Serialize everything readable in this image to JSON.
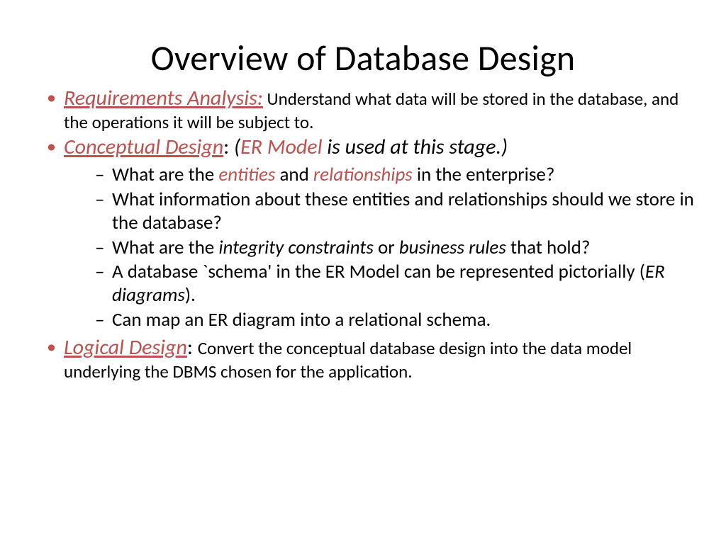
{
  "title": "Overview of Database Design",
  "bullets": [
    {
      "kw": "Requirements Analysis:",
      "rest": " Understand what data will be stored in the database, and the operations it will be subject to."
    },
    {
      "kw": "Conceptual Design",
      "colon": ":  ",
      "paren_open": "(",
      "er": "ER Model",
      "paren_rest": " is used at this stage.)",
      "subs": [
        {
          "pre": "What are the ",
          "h1": "entities",
          "mid": " and ",
          "h2": "relationships",
          "post": " in the enterprise?"
        },
        {
          "pre": "What information about these entities and relationships should we store in the database?"
        },
        {
          "pre": "What are the ",
          "i1": "integrity constraints",
          "mid": " or ",
          "i2": "business rules",
          "post": " that hold?"
        },
        {
          "pre": "A database `schema' in the ER Model can be represented pictorially (",
          "i1": "ER diagrams",
          "post": ")."
        },
        {
          "pre": "Can map an ER diagram into a relational schema."
        }
      ]
    },
    {
      "kw": "Logical Design",
      "colon": ": ",
      "rest": "Convert the conceptual database design into the data model underlying the DBMS chosen for the application."
    }
  ]
}
